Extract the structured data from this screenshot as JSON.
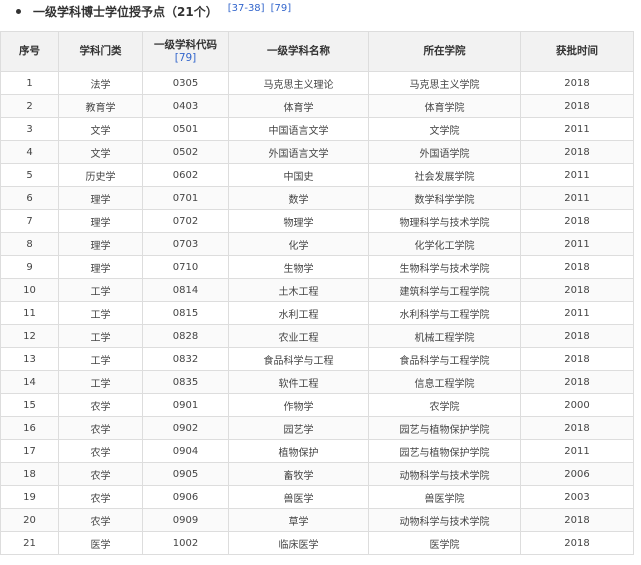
{
  "section": {
    "title": "一级学科博士学位授予点（21个）",
    "refs": [
      "[37-38]",
      "[79]"
    ]
  },
  "table": {
    "headers": {
      "seq": "序号",
      "category": "学科门类",
      "code": "一级学科代码",
      "code_ref": "[79]",
      "name": "一级学科名称",
      "college": "所在学院",
      "year": "获批时间"
    },
    "rows": [
      [
        "1",
        "法学",
        "0305",
        "马克思主义理论",
        "马克思主义学院",
        "2018"
      ],
      [
        "2",
        "教育学",
        "0403",
        "体育学",
        "体育学院",
        "2018"
      ],
      [
        "3",
        "文学",
        "0501",
        "中国语言文学",
        "文学院",
        "2011"
      ],
      [
        "4",
        "文学",
        "0502",
        "外国语言文学",
        "外国语学院",
        "2018"
      ],
      [
        "5",
        "历史学",
        "0602",
        "中国史",
        "社会发展学院",
        "2011"
      ],
      [
        "6",
        "理学",
        "0701",
        "数学",
        "数学科学学院",
        "2011"
      ],
      [
        "7",
        "理学",
        "0702",
        "物理学",
        "物理科学与技术学院",
        "2018"
      ],
      [
        "8",
        "理学",
        "0703",
        "化学",
        "化学化工学院",
        "2011"
      ],
      [
        "9",
        "理学",
        "0710",
        "生物学",
        "生物科学与技术学院",
        "2018"
      ],
      [
        "10",
        "工学",
        "0814",
        "土木工程",
        "建筑科学与工程学院",
        "2018"
      ],
      [
        "11",
        "工学",
        "0815",
        "水利工程",
        "水利科学与工程学院",
        "2011"
      ],
      [
        "12",
        "工学",
        "0828",
        "农业工程",
        "机械工程学院",
        "2018"
      ],
      [
        "13",
        "工学",
        "0832",
        "食品科学与工程",
        "食品科学与工程学院",
        "2018"
      ],
      [
        "14",
        "工学",
        "0835",
        "软件工程",
        "信息工程学院",
        "2018"
      ],
      [
        "15",
        "农学",
        "0901",
        "作物学",
        "农学院",
        "2000"
      ],
      [
        "16",
        "农学",
        "0902",
        "园艺学",
        "园艺与植物保护学院",
        "2018"
      ],
      [
        "17",
        "农学",
        "0904",
        "植物保护",
        "园艺与植物保护学院",
        "2011"
      ],
      [
        "18",
        "农学",
        "0905",
        "畜牧学",
        "动物科学与技术学院",
        "2006"
      ],
      [
        "19",
        "农学",
        "0906",
        "兽医学",
        "兽医学院",
        "2003"
      ],
      [
        "20",
        "农学",
        "0909",
        "草学",
        "动物科学与技术学院",
        "2018"
      ],
      [
        "21",
        "医学",
        "1002",
        "临床医学",
        "医学院",
        "2018"
      ]
    ]
  }
}
